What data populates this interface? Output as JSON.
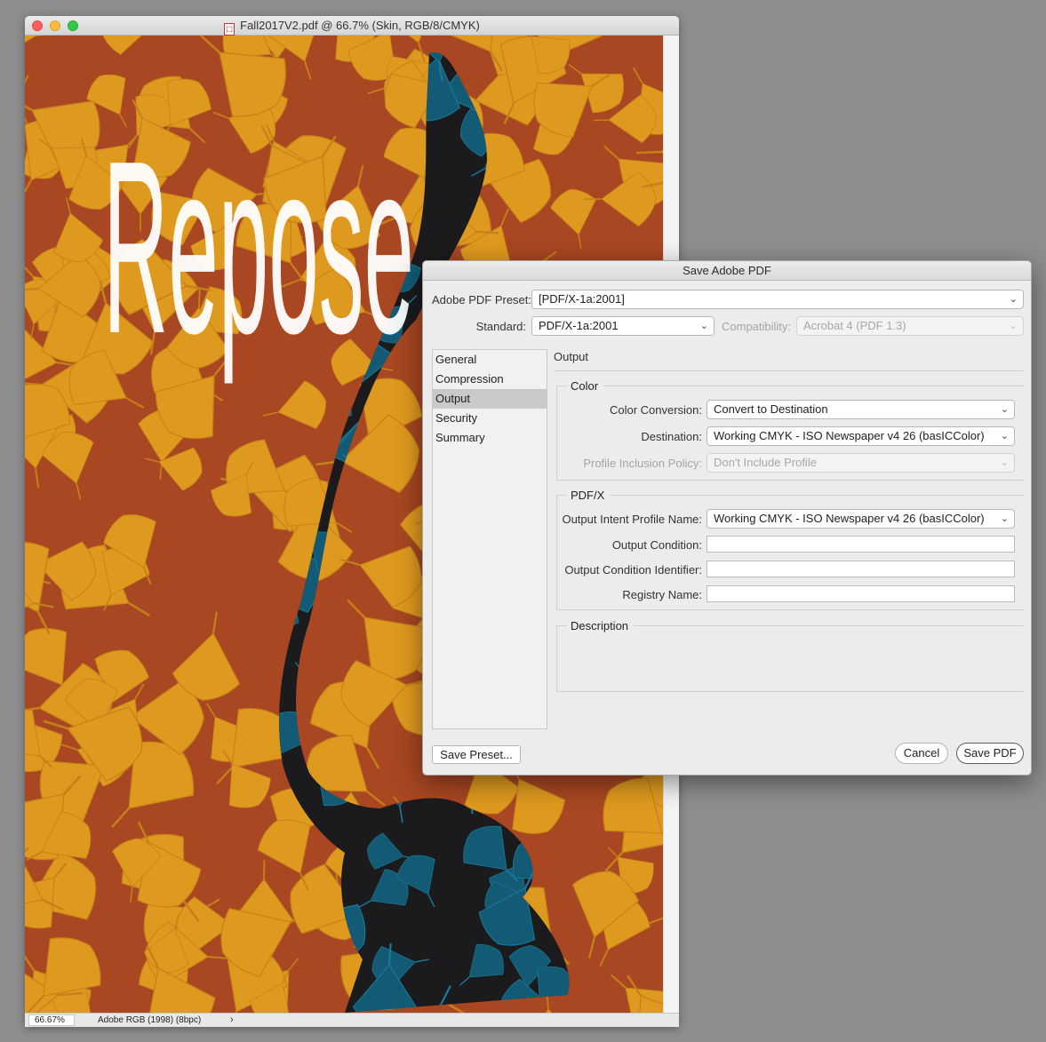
{
  "document_window": {
    "title": "Fall2017V2.pdf @ 66.7% (Skin, RGB/8/CMYK)",
    "file_icon": "pdf-file-icon",
    "artwork_text": "Repose",
    "status": {
      "zoom": "66.67%",
      "profile": "Adobe RGB (1998) (8bpc)",
      "arrow": "›"
    }
  },
  "dialog": {
    "title": "Save Adobe PDF",
    "preset_label": "Adobe PDF Preset:",
    "preset_value": "[PDF/X-1a:2001]",
    "standard_label": "Standard:",
    "standard_value": "PDF/X-1a:2001",
    "compatibility_label": "Compatibility:",
    "compatibility_value": "Acrobat 4 (PDF 1.3)",
    "sidebar": {
      "items": [
        {
          "label": "General"
        },
        {
          "label": "Compression"
        },
        {
          "label": "Output"
        },
        {
          "label": "Security"
        },
        {
          "label": "Summary"
        }
      ],
      "selected": "Output"
    },
    "section_title": "Output",
    "color_group": {
      "legend": "Color",
      "conversion_label": "Color Conversion:",
      "conversion_value": "Convert to Destination",
      "destination_label": "Destination:",
      "destination_value": "Working CMYK - ISO Newspaper v4 26 (basICColor)",
      "policy_label": "Profile Inclusion Policy:",
      "policy_value": "Don't Include Profile"
    },
    "pdfx_group": {
      "legend": "PDF/X",
      "intent_label": "Output Intent Profile Name:",
      "intent_value": "Working CMYK - ISO Newspaper v4 26 (basICColor)",
      "condition_label": "Output Condition:",
      "condition_value": "",
      "identifier_label": "Output Condition Identifier:",
      "identifier_value": "",
      "registry_label": "Registry Name:",
      "registry_value": ""
    },
    "description_group": {
      "legend": "Description"
    },
    "buttons": {
      "save_preset": "Save Preset...",
      "cancel": "Cancel",
      "save_pdf": "Save PDF"
    }
  },
  "colors": {
    "artwork_background": "#a84722",
    "leaf_gold": "#e3a21f",
    "silhouette": "#1b1a1d",
    "silhouette_pattern": "#13627f"
  }
}
